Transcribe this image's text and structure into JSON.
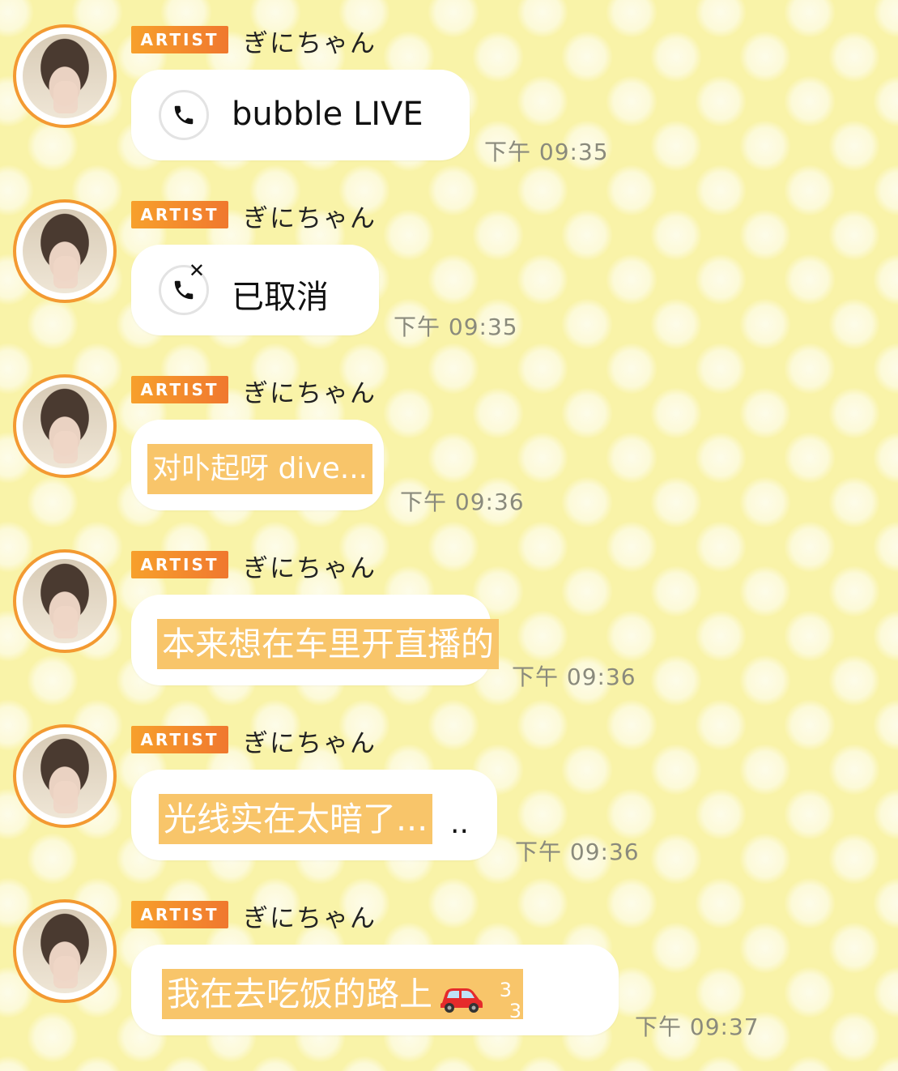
{
  "sender": {
    "badge": "ARTIST",
    "name": "ぎにちゃん"
  },
  "colors": {
    "badge": "#f3862f",
    "avatar_ring": "#f39a32",
    "highlight": "#f8c56a",
    "background": "#f9f3a8"
  },
  "messages": [
    {
      "type": "call",
      "icon": "phone-icon",
      "text": "bubble LIVE",
      "time": "下午 09:35"
    },
    {
      "type": "call-cancelled",
      "icon": "phone-cancelled-icon",
      "text": "已取消",
      "time": "下午 09:35"
    },
    {
      "type": "text",
      "text": "对卟起呀 dive...",
      "time": "下午 09:36"
    },
    {
      "type": "text",
      "text": "本来想在车里开直播的",
      "time": "下午 09:36"
    },
    {
      "type": "text",
      "text": "光线实在太暗了...",
      "trailing": "..",
      "time": "下午 09:36"
    },
    {
      "type": "text",
      "text": "我在去吃饭的路上",
      "emoji": "car-icon",
      "sup1": "3",
      "sup2": "3",
      "time": "下午 09:37"
    }
  ]
}
